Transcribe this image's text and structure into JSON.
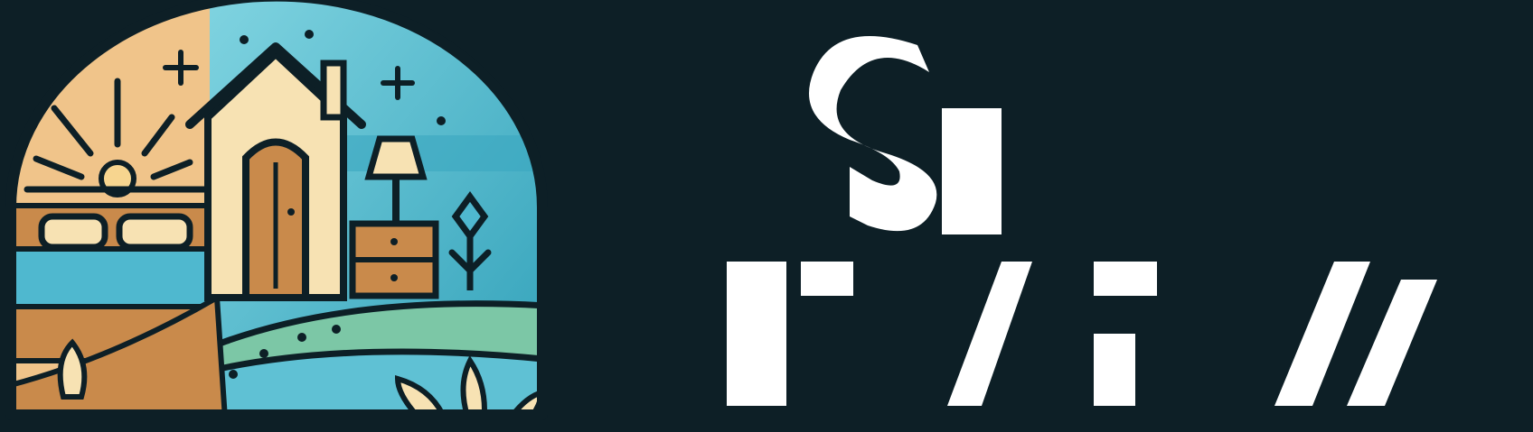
{
  "logo": {
    "emblem_icon": "house-bed-landscape-emblem",
    "wordmark_text": "",
    "colors": {
      "background": "#0d1f26",
      "outline": "#0d1f26",
      "sand": "#f0c48a",
      "wood": "#c98a4b",
      "sky": "#4fb8cf",
      "sea": "#5fc1d4",
      "field": "#7cc7a6",
      "cream": "#f7e2b3",
      "wordmark": "#ffffff"
    }
  }
}
